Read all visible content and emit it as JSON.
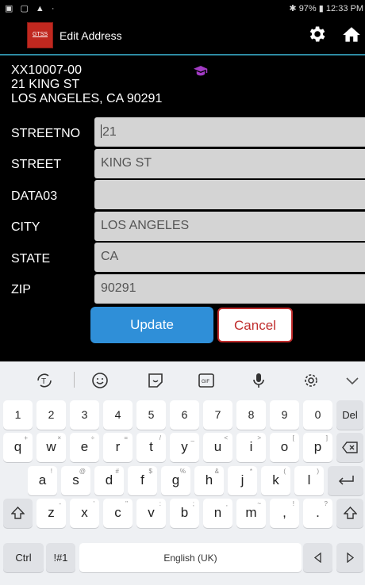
{
  "status_bar": {
    "time": "12:33 PM",
    "battery": "97%"
  },
  "app_bar": {
    "logo_text": "GTSS",
    "title": "Edit Address"
  },
  "record": {
    "code": "XX10007-00",
    "line1": "21 KING ST",
    "line2": "LOS ANGELES, CA 90291"
  },
  "form": {
    "fields": [
      {
        "label": "STREETNO",
        "value": "21"
      },
      {
        "label": "STREET",
        "value": "KING ST"
      },
      {
        "label": "DATA03",
        "value": ""
      },
      {
        "label": "CITY",
        "value": "LOS ANGELES"
      },
      {
        "label": "STATE",
        "value": "CA"
      },
      {
        "label": "ZIP",
        "value": "90291"
      }
    ],
    "update_label": "Update",
    "cancel_label": "Cancel"
  },
  "keyboard": {
    "number_row": [
      "1",
      "2",
      "3",
      "4",
      "5",
      "6",
      "7",
      "8",
      "9",
      "0",
      "Del"
    ],
    "row1": [
      {
        "k": "q",
        "s": "+"
      },
      {
        "k": "w",
        "s": "×"
      },
      {
        "k": "e",
        "s": "÷"
      },
      {
        "k": "r",
        "s": "="
      },
      {
        "k": "t",
        "s": "/"
      },
      {
        "k": "y",
        "s": "_"
      },
      {
        "k": "u",
        "s": "<"
      },
      {
        "k": "i",
        "s": ">"
      },
      {
        "k": "o",
        "s": "["
      },
      {
        "k": "p",
        "s": "]"
      }
    ],
    "row2": [
      {
        "k": "a",
        "s": "!"
      },
      {
        "k": "s",
        "s": "@"
      },
      {
        "k": "d",
        "s": "#"
      },
      {
        "k": "f",
        "s": "$"
      },
      {
        "k": "g",
        "s": "%"
      },
      {
        "k": "h",
        "s": "&"
      },
      {
        "k": "j",
        "s": "*"
      },
      {
        "k": "k",
        "s": "("
      },
      {
        "k": "l",
        "s": ")"
      }
    ],
    "row3": [
      {
        "k": "z",
        "s": "-"
      },
      {
        "k": "x",
        "s": "'"
      },
      {
        "k": "c",
        "s": "\""
      },
      {
        "k": "v",
        "s": ":"
      },
      {
        "k": "b",
        "s": ";"
      },
      {
        "k": "n",
        "s": ","
      },
      {
        "k": "m",
        "s": "~"
      },
      {
        "k": ",",
        "s": "!"
      },
      {
        "k": ".",
        "s": "?"
      }
    ],
    "ctrl_label": "Ctrl",
    "symbols_label": "!#1",
    "space_label": "English (UK)"
  },
  "colors": {
    "accent": "#2f8fd8",
    "cancel": "#c02d2d",
    "logo": "#c0281f",
    "cap_icon": "#a23bc4"
  }
}
